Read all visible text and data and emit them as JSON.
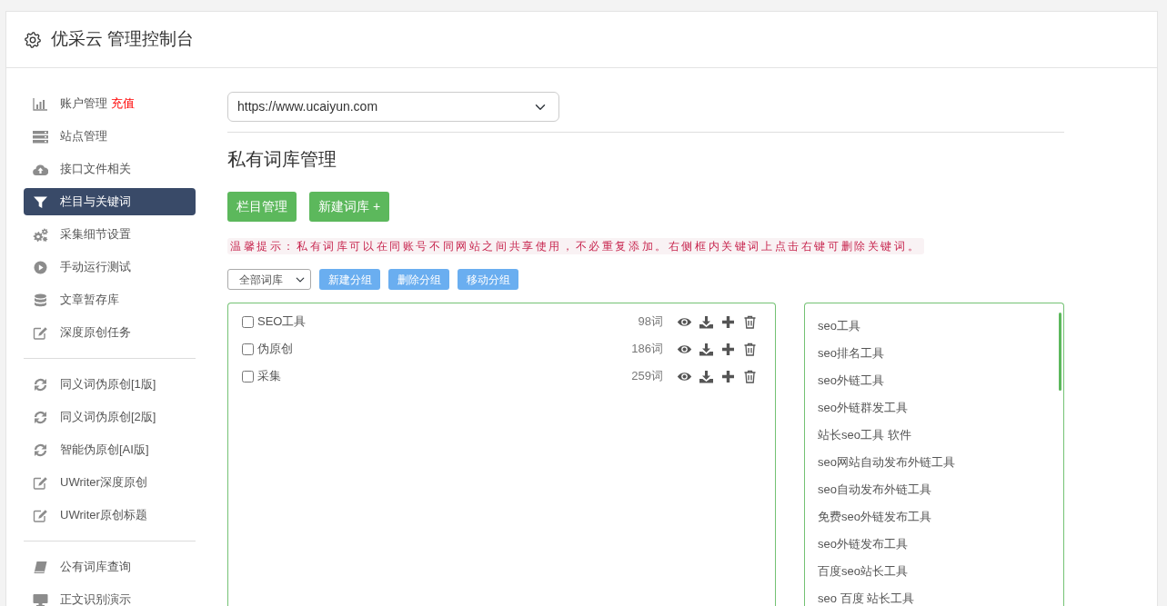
{
  "header": {
    "title": "优采云 管理控制台"
  },
  "sidebar": {
    "groups": [
      {
        "items": [
          {
            "label": "账户管理",
            "link": "充值",
            "selected": false
          },
          {
            "label": "站点管理",
            "selected": false
          },
          {
            "label": "接口文件相关",
            "selected": false
          },
          {
            "label": "栏目与关键词",
            "selected": true
          },
          {
            "label": "采集细节设置",
            "selected": false
          },
          {
            "label": "手动运行测试",
            "selected": false
          },
          {
            "label": "文章暂存库",
            "selected": false
          },
          {
            "label": "深度原创任务",
            "selected": false
          }
        ]
      },
      {
        "items": [
          {
            "label": "同义词伪原创[1版]",
            "selected": false
          },
          {
            "label": "同义词伪原创[2版]",
            "selected": false
          },
          {
            "label": "智能伪原创[AI版]",
            "selected": false
          },
          {
            "label": "UWriter深度原创",
            "selected": false
          },
          {
            "label": "UWriter原创标题",
            "selected": false
          }
        ]
      },
      {
        "items": [
          {
            "label": "公有词库查询",
            "selected": false
          },
          {
            "label": "正文识别演示",
            "selected": false
          }
        ]
      }
    ]
  },
  "main": {
    "site_select": {
      "value": "https://www.ucaiyun.com"
    },
    "heading": "私有词库管理",
    "buttons": [
      "栏目管理",
      "新建词库 +"
    ],
    "hint": "温馨提示：私有词库可以在同账号不同网站之间共享使用，不必重复添加。右侧框内关键词上点击右键可删除关键词。",
    "group_select": {
      "value": "全部词库"
    },
    "group_buttons": [
      "新建分组",
      "删除分组",
      "移动分组"
    ],
    "libraries": [
      {
        "name": "SEO工具",
        "count": "98词",
        "checked": false
      },
      {
        "name": "伪原创",
        "count": "186词",
        "checked": false
      },
      {
        "name": "采集",
        "count": "259词",
        "checked": false
      }
    ],
    "keywords": [
      "seo工具",
      "seo排名工具",
      "seo外链工具",
      "seo外链群发工具",
      "站长seo工具 软件",
      "seo网站自动发布外链工具",
      "seo自动发布外链工具",
      "免费seo外链发布工具",
      "seo外链发布工具",
      "百度seo站长工具",
      "seo 百度 站长工具"
    ]
  }
}
